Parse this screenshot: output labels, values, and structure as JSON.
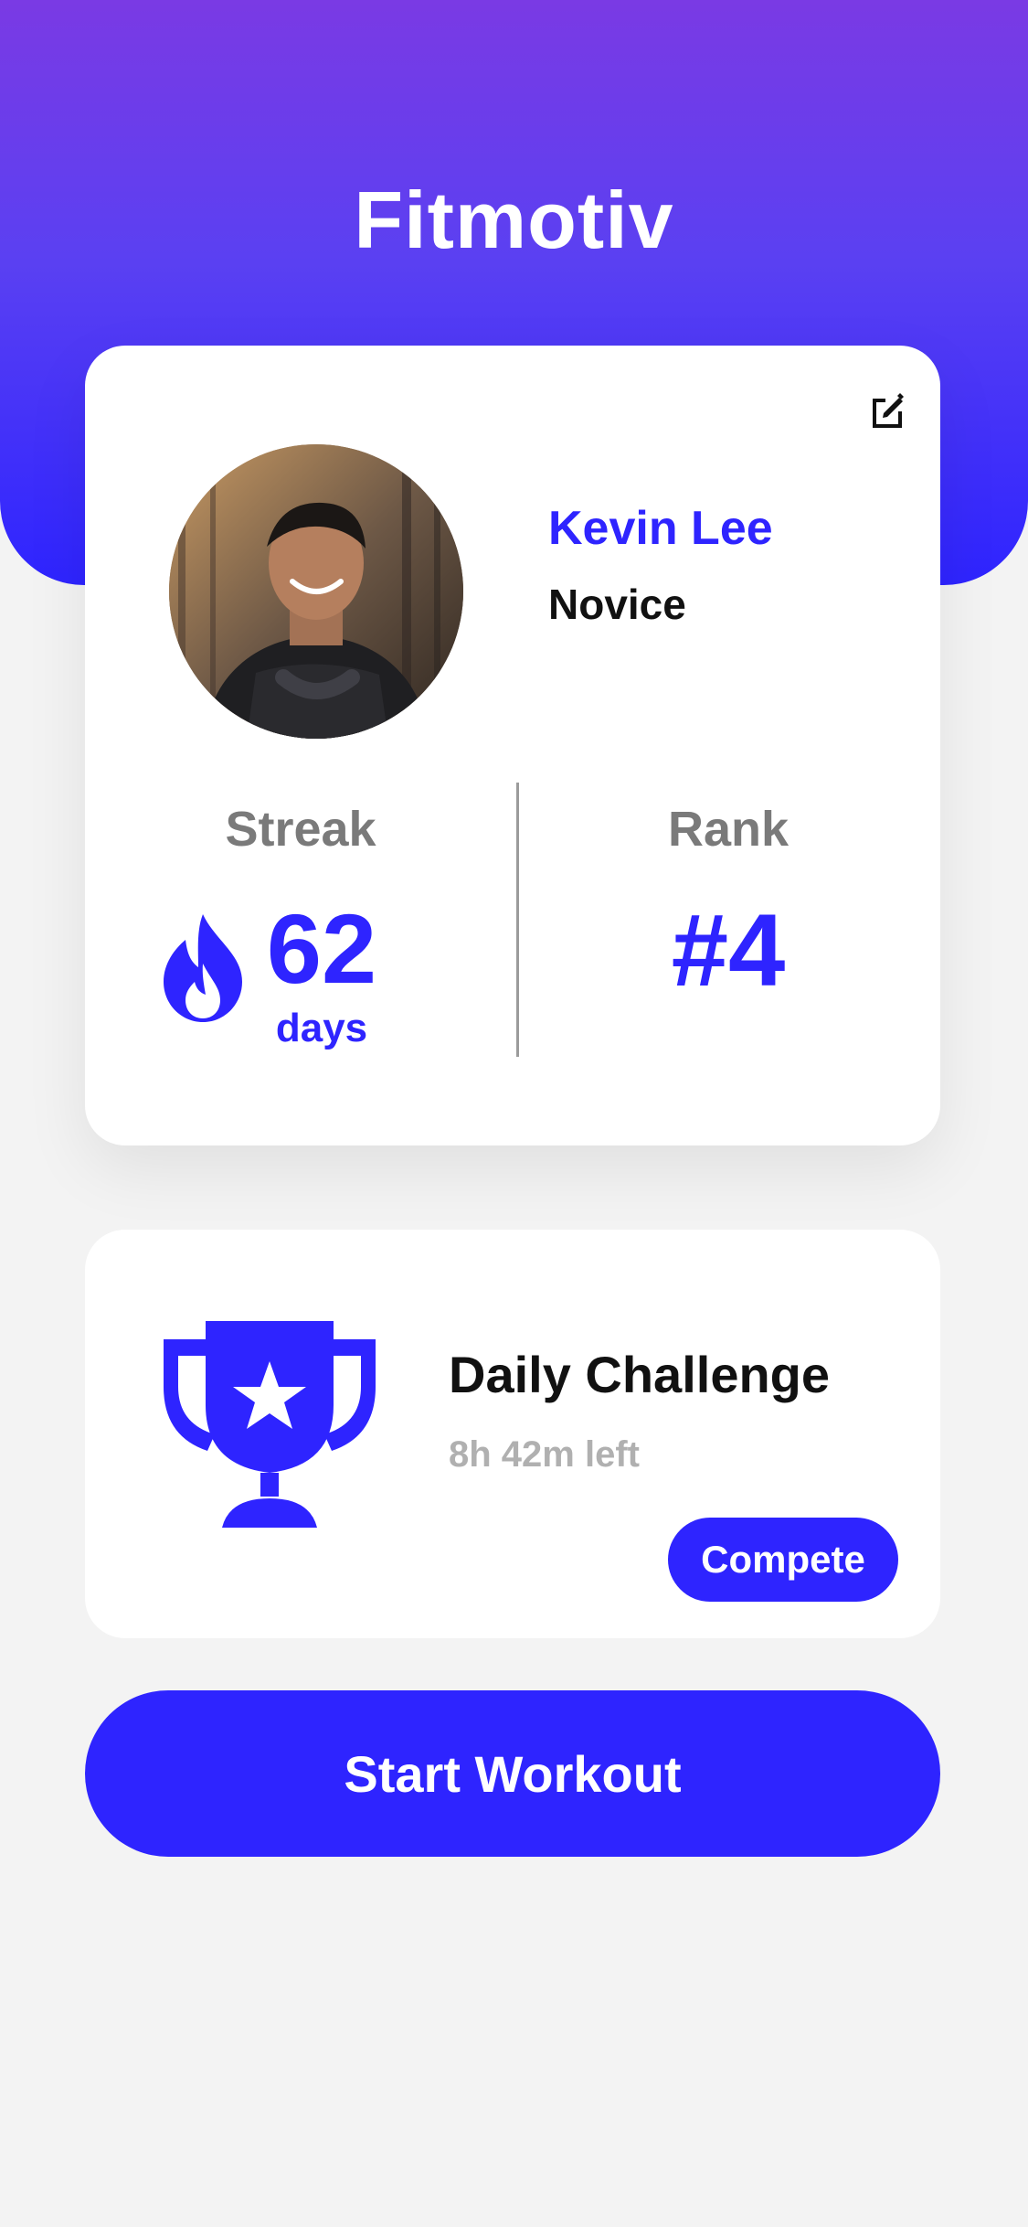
{
  "app": {
    "title": "Fitmotiv"
  },
  "profile": {
    "name": "Kevin Lee",
    "level": "Novice",
    "edit_icon": "edit-icon"
  },
  "stats": {
    "streak": {
      "label": "Streak",
      "value": "62",
      "unit": "days",
      "icon": "flame-icon"
    },
    "rank": {
      "label": "Rank",
      "value": "#4"
    }
  },
  "challenge": {
    "title": "Daily Challenge",
    "time_left": "8h 42m left",
    "button_label": "Compete",
    "icon": "trophy-icon"
  },
  "actions": {
    "start_label": "Start Workout"
  },
  "colors": {
    "accent": "#2e24ff",
    "header_top": "#7a3ae4",
    "header_bottom": "#2e24ff",
    "background": "#f3f3f3",
    "muted_text": "#7a7a7a"
  }
}
